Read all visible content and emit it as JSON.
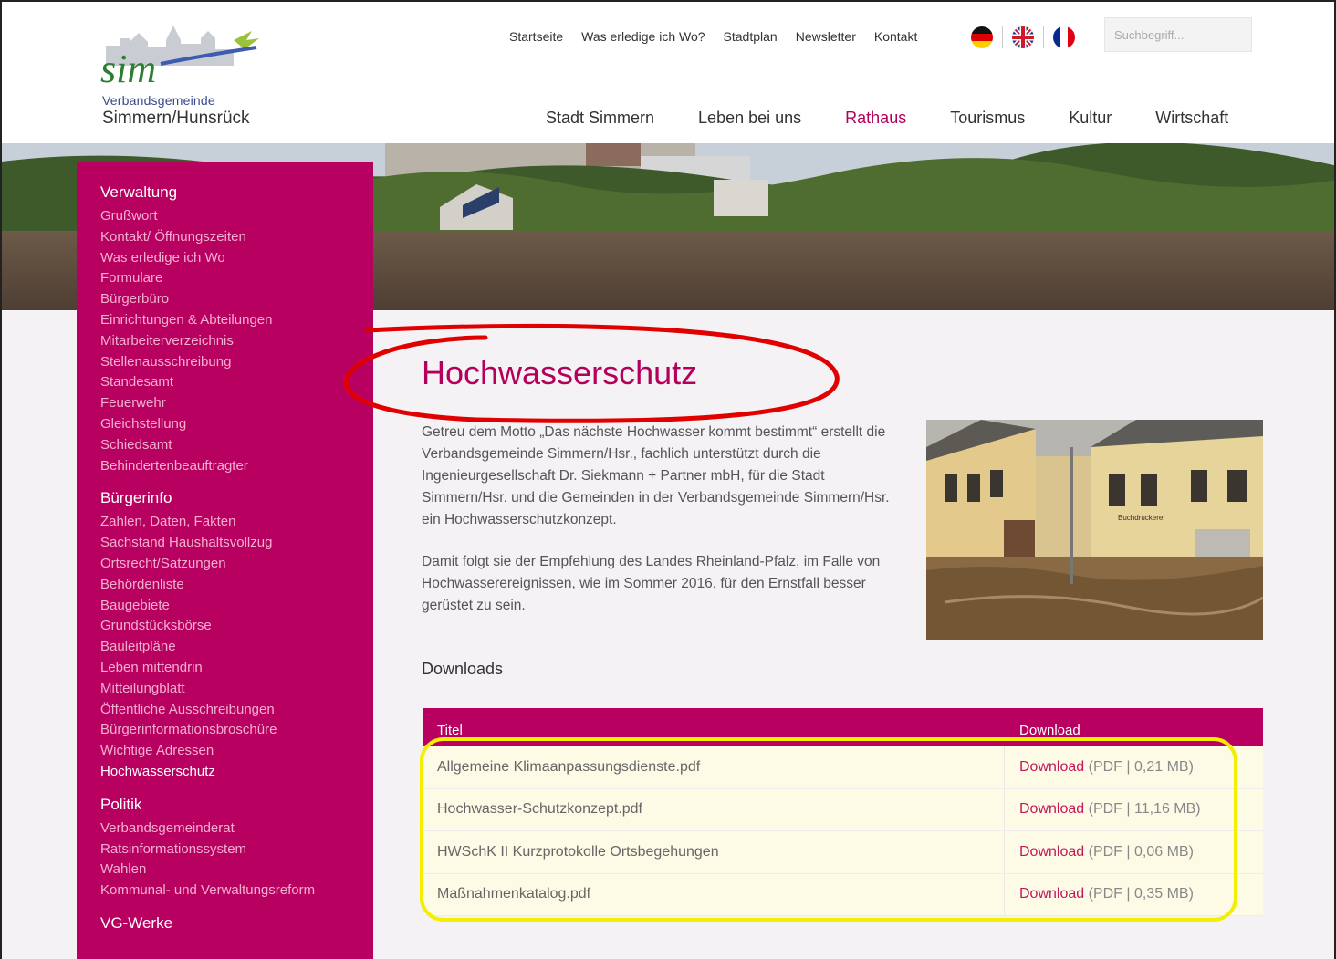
{
  "header": {
    "logo_mark": "sim",
    "logo_subtitle": "Verbandsgemeinde",
    "logo_title": "Simmern/Hunsrück",
    "top_links": [
      "Startseite",
      "Was erledige ich Wo?",
      "Stadtplan",
      "Newsletter",
      "Kontakt"
    ],
    "languages": [
      "de",
      "en",
      "fr"
    ],
    "search_placeholder": "Suchbegriff...",
    "main_nav": [
      "Stadt Simmern",
      "Leben bei uns",
      "Rathaus",
      "Tourismus",
      "Kultur",
      "Wirtschaft"
    ],
    "main_nav_active": "Rathaus"
  },
  "sidebar": {
    "groups": [
      {
        "title": "Verwaltung",
        "items": [
          "Grußwort",
          "Kontakt/ Öffnungszeiten",
          "Was erledige ich Wo",
          "Formulare",
          "Bürgerbüro",
          "Einrichtungen & Abteilungen",
          "Mitarbeiterverzeichnis",
          "Stellenausschreibung",
          "Standesamt",
          "Feuerwehr",
          "Gleichstellung",
          "Schiedsamt",
          "Behindertenbeauftragter"
        ]
      },
      {
        "title": "Bürgerinfo",
        "items": [
          "Zahlen, Daten, Fakten",
          "Sachstand Haushaltsvollzug",
          "Ortsrecht/Satzungen",
          "Behördenliste",
          "Baugebiete",
          "Grundstücksbörse",
          "Bauleitpläne",
          "Leben mittendrin",
          "Mitteilungblatt",
          "Öffentliche Ausschreibungen",
          "Bürgerinformationsbroschüre",
          "Wichtige Adressen",
          "Hochwasserschutz"
        ]
      },
      {
        "title": "Politik",
        "items": [
          "Verbandsgemeinderat",
          "Ratsinformationssystem",
          "Wahlen",
          "Kommunal- und Verwaltungsreform"
        ]
      },
      {
        "title": "VG-Werke",
        "items": []
      }
    ],
    "current_item": "Hochwasserschutz"
  },
  "content": {
    "title": "Hochwasserschutz",
    "paragraph1": "Getreu dem Motto „Das nächste Hochwasser kommt bestimmt“ erstellt die Verbandsgemeinde Simmern/Hsr., fachlich unterstützt durch die Ingenieurgesellschaft Dr. Siekmann + Partner mbH, für die Stadt Simmern/Hsr. und die Gemeinden in der Verbandsgemeinde Simmern/Hsr. ein Hochwasserschutzkonzept.",
    "paragraph2": "Damit folgt sie der Empfehlung des Landes Rheinland-Pfalz, im Falle von Hochwasserereignissen, wie im Sommer 2016, für den Ernstfall besser gerüstet zu sein.",
    "photo_sign": "Buchdruckerei",
    "downloads_heading": "Downloads",
    "table": {
      "col_title": "Titel",
      "col_download": "Download",
      "rows": [
        {
          "title": "Allgemeine Klimaanpassungsdienste.pdf",
          "link": "Download",
          "info": "(PDF | 0,21 MB)"
        },
        {
          "title": "Hochwasser-Schutzkonzept.pdf",
          "link": "Download",
          "info": "(PDF | 11,16 MB)"
        },
        {
          "title": "HWSchK II Kurzprotokolle Ortsbegehungen",
          "link": "Download",
          "info": "(PDF | 0,06 MB)"
        },
        {
          "title": "Maßnahmenkatalog.pdf",
          "link": "Download",
          "info": "(PDF | 0,35 MB)"
        }
      ]
    }
  },
  "colors": {
    "brand": "#b80060",
    "title": "#b5005b",
    "annotation_red": "#e00000",
    "annotation_yellow": "#f4ee00"
  }
}
